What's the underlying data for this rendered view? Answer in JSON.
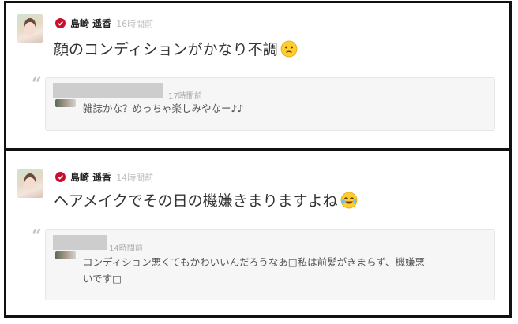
{
  "posts": [
    {
      "author": "島崎 遥香",
      "time": "16時間前",
      "message": "顔のコンディションがかなり不調",
      "emoji_icon": "sad-face-emoji",
      "reply": {
        "time": "17時間前",
        "text_lines": [
          "雑誌かな？めっちゃ楽しみやなー♪♪"
        ]
      }
    },
    {
      "author": "島崎 遥香",
      "time": "14時間前",
      "message": "ヘアメイクでその日の機嫌きまりますよね",
      "emoji_icon": "tears-of-joy-emoji",
      "reply": {
        "time": "14時間前",
        "text_lines": [
          "コンディション悪くてもかわいいんだろうなあ□私は前髪がきまらず、機嫌悪",
          "いです□"
        ]
      }
    }
  ],
  "colors": {
    "verified_badge": "#c8102e",
    "border": "#111111",
    "reply_bg": "#f6f6f6"
  }
}
